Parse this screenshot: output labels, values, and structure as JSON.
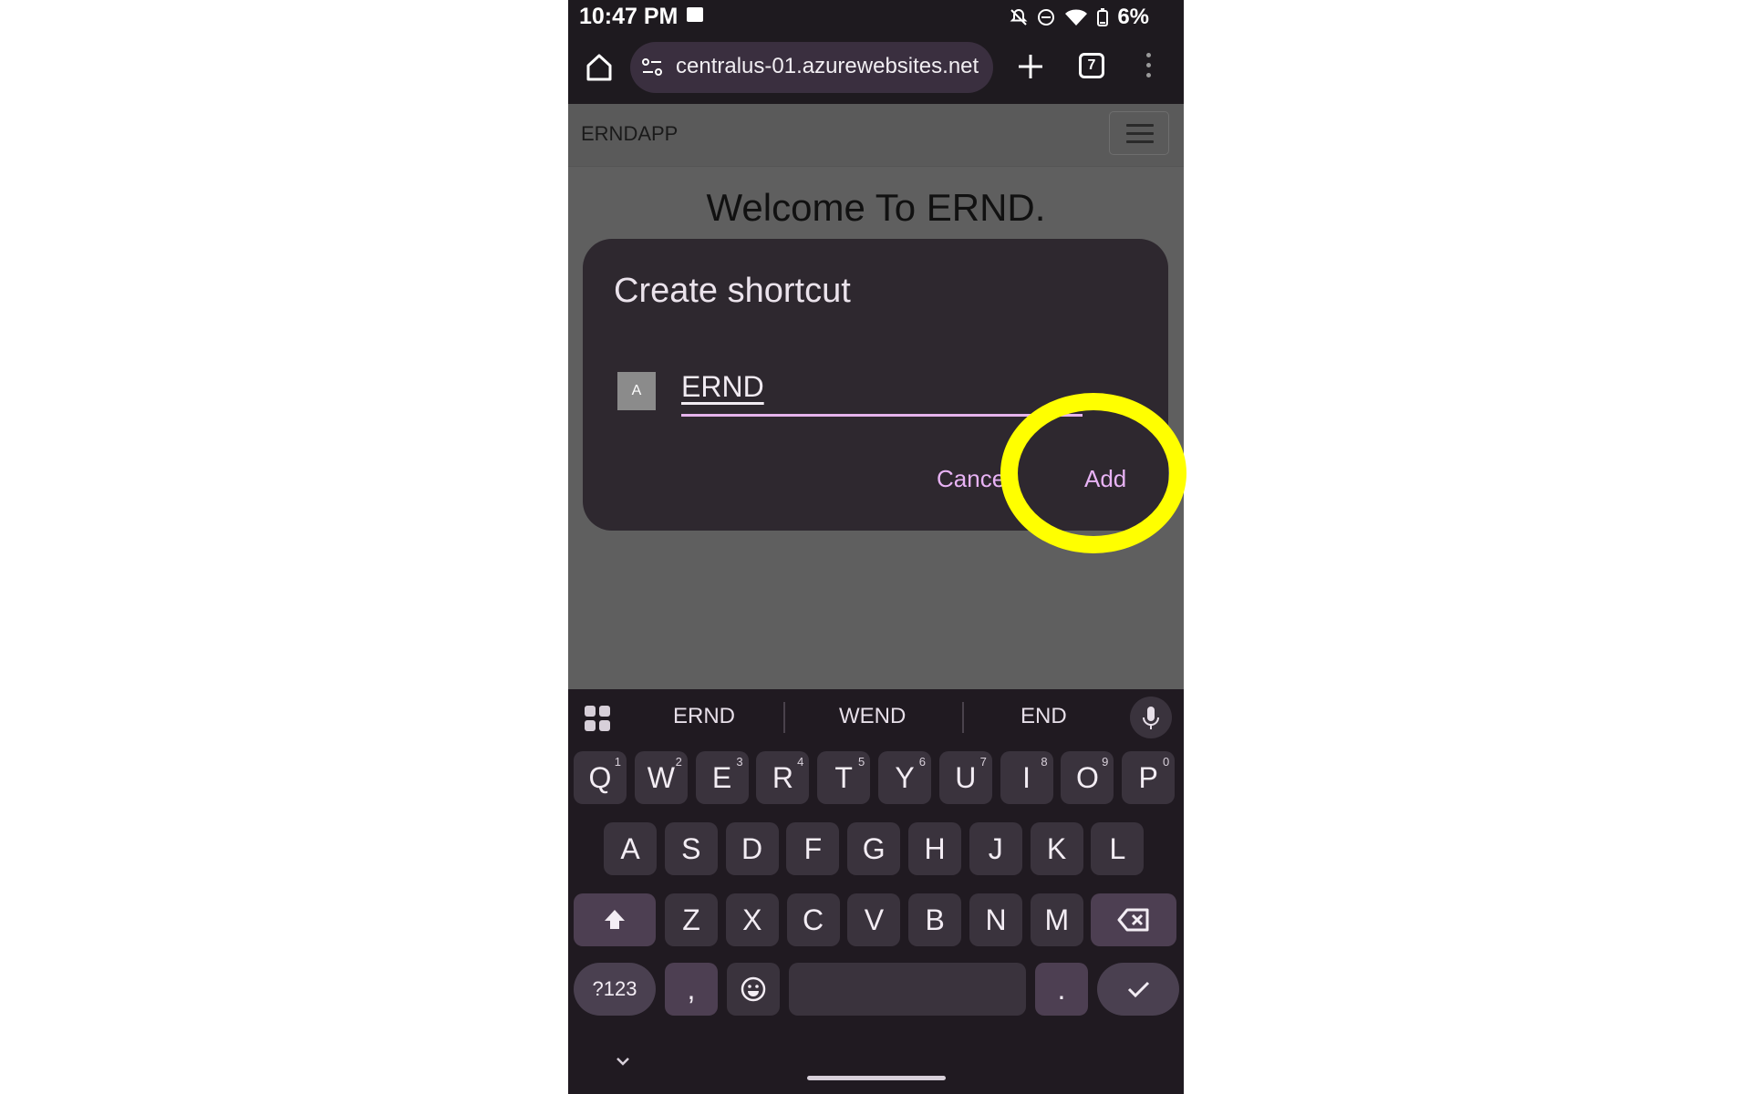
{
  "status_bar": {
    "time": "10:47 PM",
    "battery": "6%"
  },
  "browser": {
    "url": "centralus-01.azurewebsites.net",
    "tab_count": "7"
  },
  "page": {
    "brand": "ERNDAPP",
    "welcome": "Welcome To ERND."
  },
  "dialog": {
    "title": "Create shortcut",
    "favicon_letter": "A",
    "name_value": "ERND",
    "cancel_label": "Cance",
    "add_label": "Add"
  },
  "keyboard": {
    "suggestions": [
      "ERND",
      "WEND",
      "END"
    ],
    "row1": [
      {
        "key": "Q",
        "hint": "1"
      },
      {
        "key": "W",
        "hint": "2"
      },
      {
        "key": "E",
        "hint": "3"
      },
      {
        "key": "R",
        "hint": "4"
      },
      {
        "key": "T",
        "hint": "5"
      },
      {
        "key": "Y",
        "hint": "6"
      },
      {
        "key": "U",
        "hint": "7"
      },
      {
        "key": "I",
        "hint": "8"
      },
      {
        "key": "O",
        "hint": "9"
      },
      {
        "key": "P",
        "hint": "0"
      }
    ],
    "row2": [
      "A",
      "S",
      "D",
      "F",
      "G",
      "H",
      "J",
      "K",
      "L"
    ],
    "row3": [
      "Z",
      "X",
      "C",
      "V",
      "B",
      "N",
      "M"
    ],
    "symbols_label": "?123",
    "comma": ",",
    "period": "."
  },
  "colors": {
    "accent": "#e8b3f5",
    "highlight": "#ffff00"
  }
}
